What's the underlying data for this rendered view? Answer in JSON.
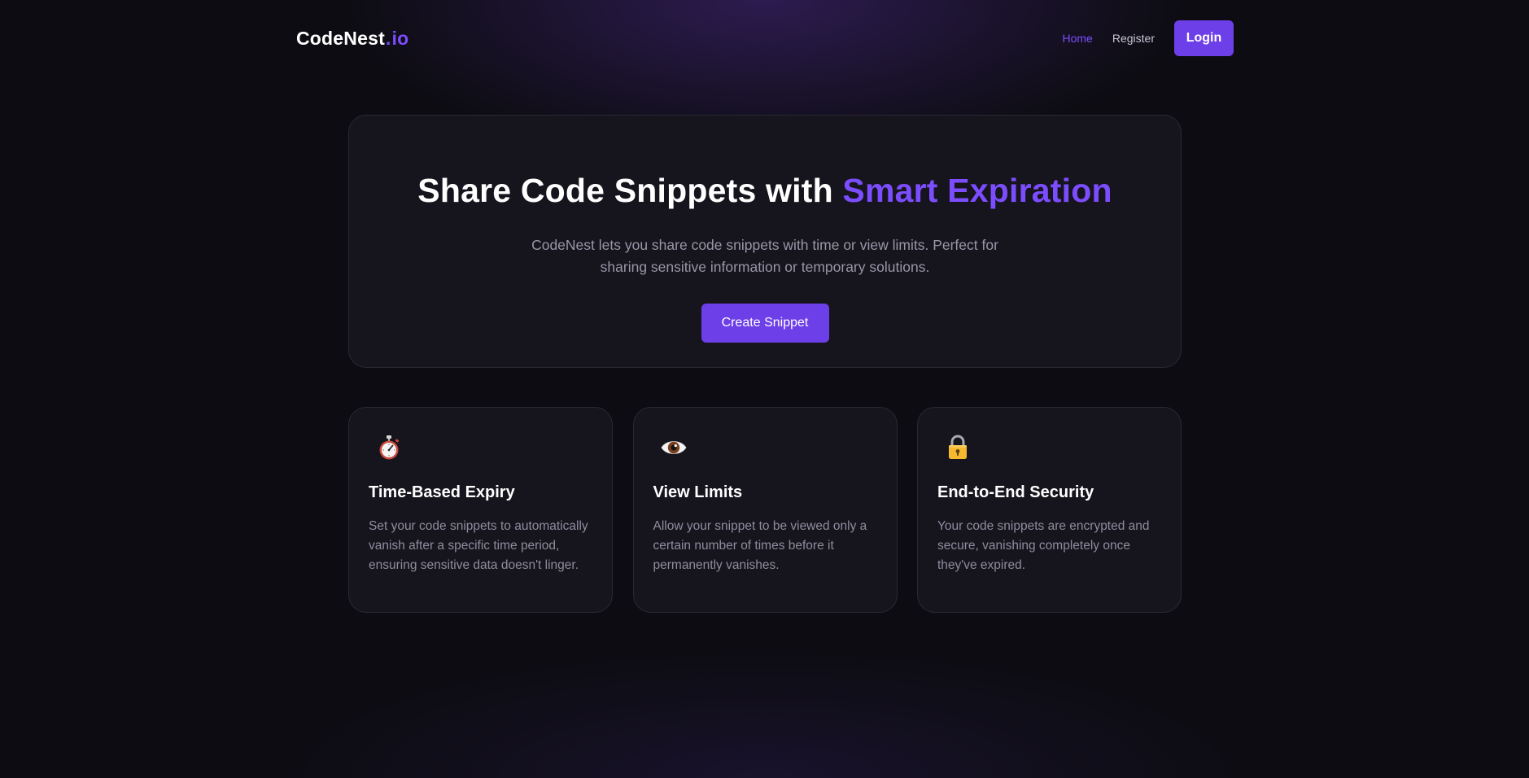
{
  "nav": {
    "logo_main": "CodeNest",
    "logo_dot": ".",
    "logo_suffix": "io",
    "links": [
      {
        "label": "Home",
        "active": true
      },
      {
        "label": "Register",
        "active": false
      }
    ],
    "login_label": "Login"
  },
  "hero": {
    "title_plain": "Share Code Snippets with ",
    "title_accent": "Smart Expiration",
    "description": "CodeNest lets you share code snippets with time or view limits. Perfect for sharing sensitive information or temporary solutions.",
    "cta_label": "Create Snippet"
  },
  "features": [
    {
      "icon": "stopwatch-icon",
      "title": "Time-Based Expiry",
      "description": "Set your code snippets to automatically vanish after a specific time period, ensuring sensitive data doesn't linger."
    },
    {
      "icon": "eye-icon",
      "title": "View Limits",
      "description": "Allow your snippet to be viewed only a certain number of times before it permanently vanishes."
    },
    {
      "icon": "lock-icon",
      "title": "End-to-End Security",
      "description": "Your code snippets are encrypted and secure, vanishing completely once they've expired."
    }
  ],
  "colors": {
    "accent": "#7c4dff",
    "button": "#6d3fe8",
    "background": "#0d0c12",
    "card": "#16151d",
    "muted_text": "#9996a8"
  }
}
